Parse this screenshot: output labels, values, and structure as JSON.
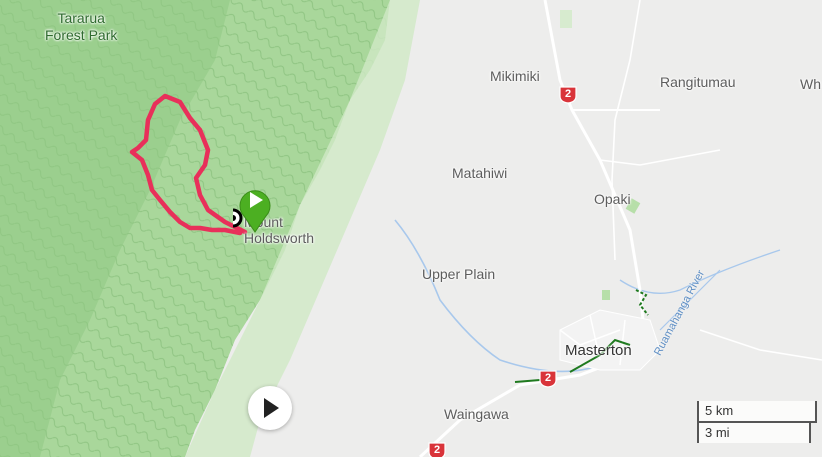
{
  "map": {
    "labels": {
      "park": "Tararua\nForest Park",
      "mikimiki": "Mikimiki",
      "rangitumau": "Rangitumau",
      "wh": "Wh",
      "matahiwi": "Matahiwi",
      "opaki": "Opaki",
      "mount": "Mount\nHoldsworth",
      "upper_plain": "Upper Plain",
      "masterton": "Masterton",
      "waingawa": "Waingawa",
      "river": "Ruamahanga River"
    },
    "highway_number": "2"
  },
  "route": {
    "color": "#e8305a"
  },
  "controls": {
    "play_icon": "play-icon",
    "marker_icon": "start-marker-icon"
  },
  "scale": {
    "km": "5 km",
    "mi": "3 mi"
  },
  "colors": {
    "terrain": "#a8d69a",
    "terrain_dark": "#86c37a",
    "marker_green": "#4caf22",
    "highway_red": "#d9343a"
  }
}
